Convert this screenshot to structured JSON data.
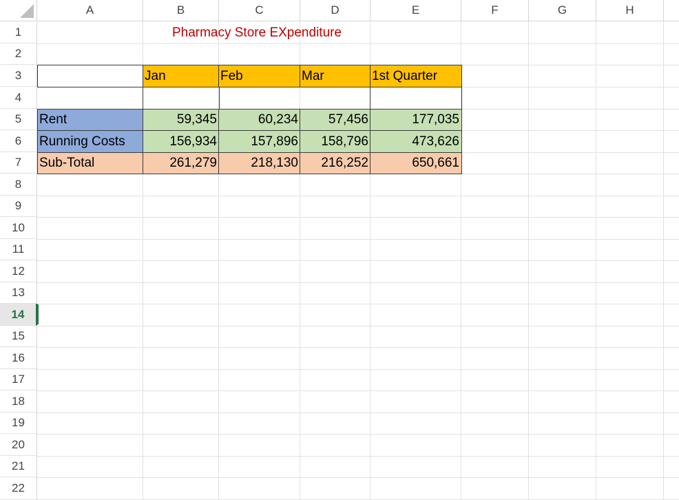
{
  "columns": [
    "A",
    "B",
    "C",
    "D",
    "E",
    "F",
    "G",
    "H"
  ],
  "rows": [
    "1",
    "2",
    "3",
    "4",
    "5",
    "6",
    "7",
    "8",
    "9",
    "10",
    "11",
    "12",
    "13",
    "14",
    "15",
    "16",
    "17",
    "18",
    "19",
    "20",
    "21",
    "22"
  ],
  "active_row": "14",
  "sheet": {
    "title": "Pharmacy Store EXpenditure",
    "headers": {
      "jan": "Jan",
      "feb": "Feb",
      "mar": "Mar",
      "q1": "1st Quarter"
    },
    "rent": {
      "label": "Rent",
      "jan": "59,345",
      "feb": "60,234",
      "mar": "57,456",
      "q1": "177,035"
    },
    "running": {
      "label": "Running Costs",
      "jan": "156,934",
      "feb": "157,896",
      "mar": "158,796",
      "q1": "473,626"
    },
    "subtotal": {
      "label": "Sub-Total",
      "jan": "261,279",
      "feb": "218,130",
      "mar": "216,252",
      "q1": "650,661"
    }
  },
  "colors": {
    "header_fill": "#ffc000",
    "label_fill": "#8eaadb",
    "data_fill": "#c6e0b4",
    "subtotal_fill": "#f8cbad",
    "title_color": "#c00000"
  }
}
